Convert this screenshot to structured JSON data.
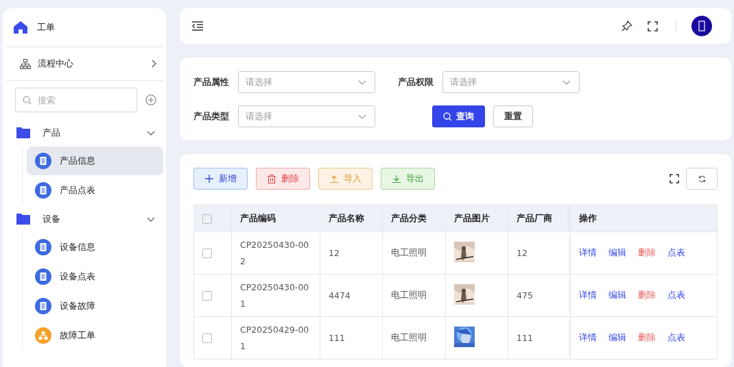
{
  "sidebar": {
    "title": "工单",
    "flow": {
      "label": "流程中心"
    },
    "search": {
      "placeholder": "搜索"
    },
    "tree": [
      {
        "label": "产品",
        "expanded": true,
        "children": [
          {
            "label": "产品信息",
            "selected": true,
            "kind": "doc"
          },
          {
            "label": "产品点表",
            "selected": false,
            "kind": "doc"
          }
        ]
      },
      {
        "label": "设备",
        "expanded": true,
        "children": [
          {
            "label": "设备信息",
            "selected": false,
            "kind": "doc"
          },
          {
            "label": "设备点表",
            "selected": false,
            "kind": "doc"
          },
          {
            "label": "设备故障",
            "selected": false,
            "kind": "doc"
          },
          {
            "label": "故障工单",
            "selected": false,
            "kind": "org"
          }
        ]
      }
    ]
  },
  "filters": [
    {
      "label": "产品属性",
      "placeholder": "请选择"
    },
    {
      "label": "产品权限",
      "placeholder": "请选择"
    },
    {
      "label": "产品类型",
      "placeholder": "请选择"
    }
  ],
  "filter_buttons": [
    {
      "label": "查询",
      "kind": "primary"
    },
    {
      "label": "重置",
      "kind": "plain"
    }
  ],
  "toolbar": [
    {
      "label": "新增",
      "kind": "add"
    },
    {
      "label": "删除",
      "kind": "delete"
    },
    {
      "label": "导入",
      "kind": "import"
    },
    {
      "label": "导出",
      "kind": "export"
    }
  ],
  "table": {
    "all_checked": false,
    "columns": [
      "产品编码",
      "产品名称",
      "产品分类",
      "产品图片",
      "产品厂商",
      "操作"
    ],
    "rows": [
      {
        "checked": false,
        "code": "CP20250430-002",
        "name": "12",
        "category": "电工照明",
        "maker": "12",
        "actions": [
          "详情",
          "编辑",
          "删除",
          "点表"
        ]
      },
      {
        "checked": false,
        "code": "CP20250430-001",
        "name": "4474",
        "category": "电工照明",
        "maker": "475",
        "actions": [
          "详情",
          "编辑",
          "删除",
          "点表"
        ]
      },
      {
        "checked": false,
        "code": "CP20250429-001",
        "name": "111",
        "category": "电工照明",
        "maker": "111",
        "actions": [
          "详情",
          "编辑",
          "删除",
          "点表"
        ]
      }
    ]
  }
}
